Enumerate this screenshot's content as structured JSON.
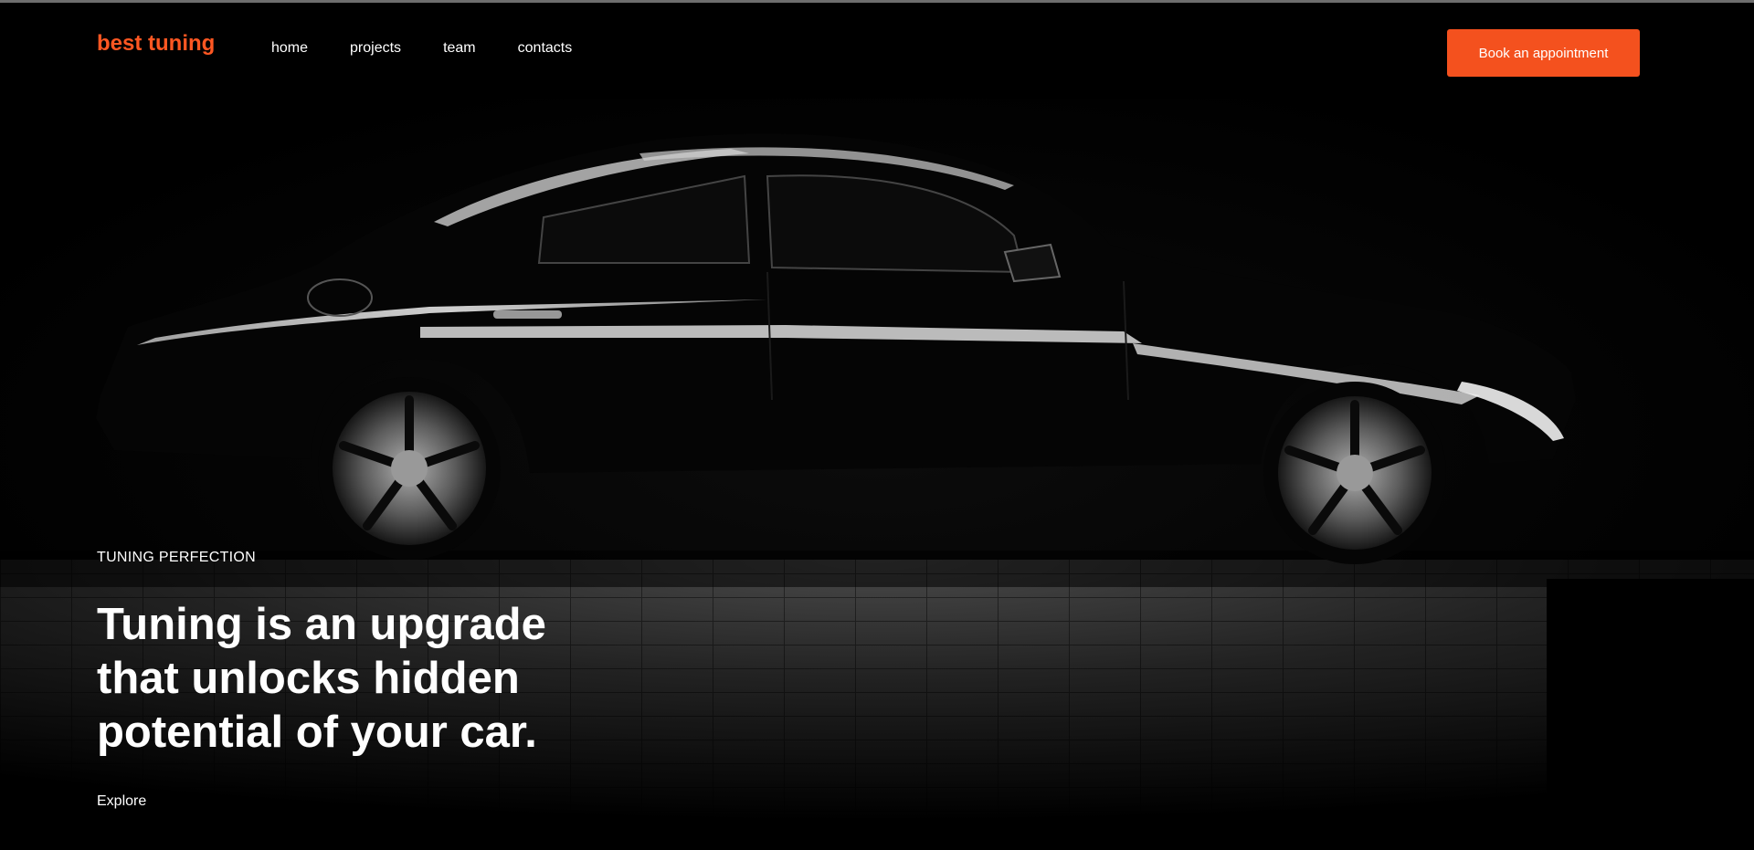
{
  "header": {
    "logo": "best tuning",
    "nav": [
      {
        "label": "home"
      },
      {
        "label": "projects"
      },
      {
        "label": "team"
      },
      {
        "label": "contacts"
      }
    ],
    "cta_label": "Book an appointment"
  },
  "hero": {
    "eyebrow": "TUNING PERFECTION",
    "headline": "Tuning is an upgrade that unlocks hidden potential of your car.",
    "explore_label": "Explore",
    "image": "black-sports-car-side-view"
  },
  "colors": {
    "accent": "#f4511e",
    "logo": "#ff5722",
    "background": "#000000",
    "text": "#ffffff"
  }
}
